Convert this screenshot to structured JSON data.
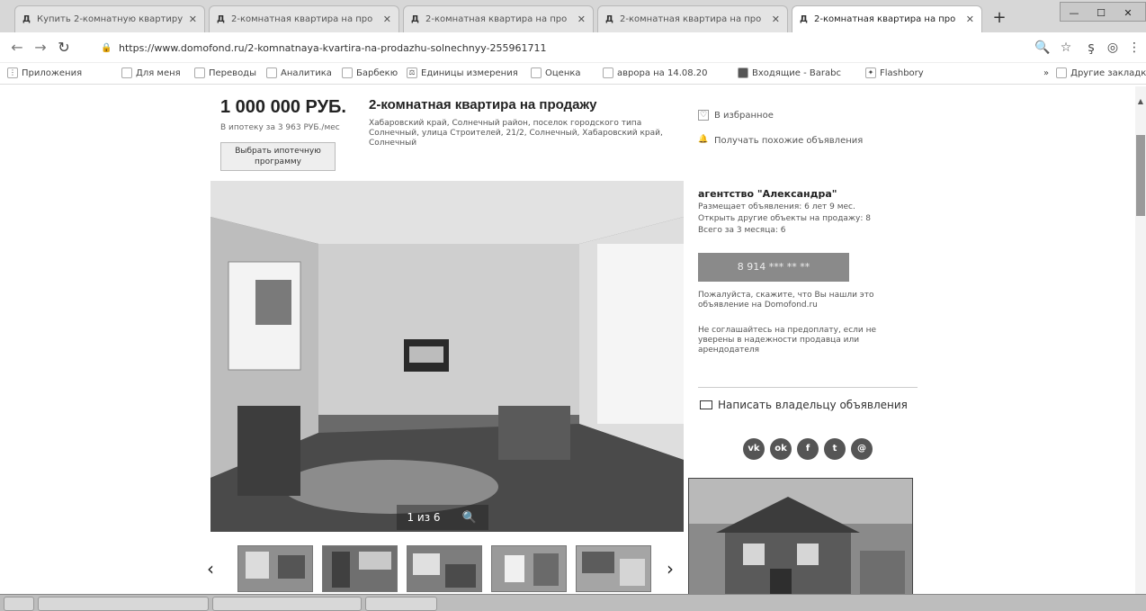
{
  "browser": {
    "tabs": [
      {
        "label": "Купить 2-комнатную квартиру"
      },
      {
        "label": "2-комнатная квартира на про"
      },
      {
        "label": "2-комнатная квартира на про"
      },
      {
        "label": "2-комнатная квартира на про"
      },
      {
        "label": "2-комнатная квартира на про",
        "active": true
      }
    ],
    "url": "https://www.domofond.ru/2-komnatnaya-kvartira-na-prodazhu-solnechnyy-255961711",
    "bookmarks": [
      "Приложения",
      "Для меня",
      "Переводы",
      "Аналитика",
      "Барбекю",
      "Единицы измерения",
      "Оценка",
      "аврора на 14.08.20",
      "Входящие - Barabc",
      "Flashbory"
    ],
    "other_bookmarks": "Другие закладки"
  },
  "listing": {
    "price": "1 000 000 РУБ.",
    "mortgage_text": "В ипотеку за 3 963 РУБ./мес",
    "mortgage_button": "Выбрать ипотечную программу",
    "title": "2-комнатная квартира на продажу",
    "address": "Хабаровский край, Солнечный район, поселок городского типа Солнечный, улица Строителей, 21/2, Солнечный, Хабаровский край, Солнечный",
    "favorite_link": "В избранное",
    "notify_link": "Получать похожие объявления",
    "photo_counter": "1 из 6"
  },
  "agency": {
    "name": "агентство \"Александра\"",
    "lines": [
      "Размещает объявления: 6 лет 9 мес.",
      "Открыть другие объекты на продажу: 8",
      "Всего за 3 месяца: 6"
    ],
    "phone": "8 914 *** ** **",
    "note1": "Пожалуйста, скажите, что Вы нашли это объявление на Domofond.ru",
    "note2": "Не соглашайтесь на предоплату, если не уверены в надежности продавца или арендодателя",
    "write_owner": "Написать владельцу объявления"
  }
}
